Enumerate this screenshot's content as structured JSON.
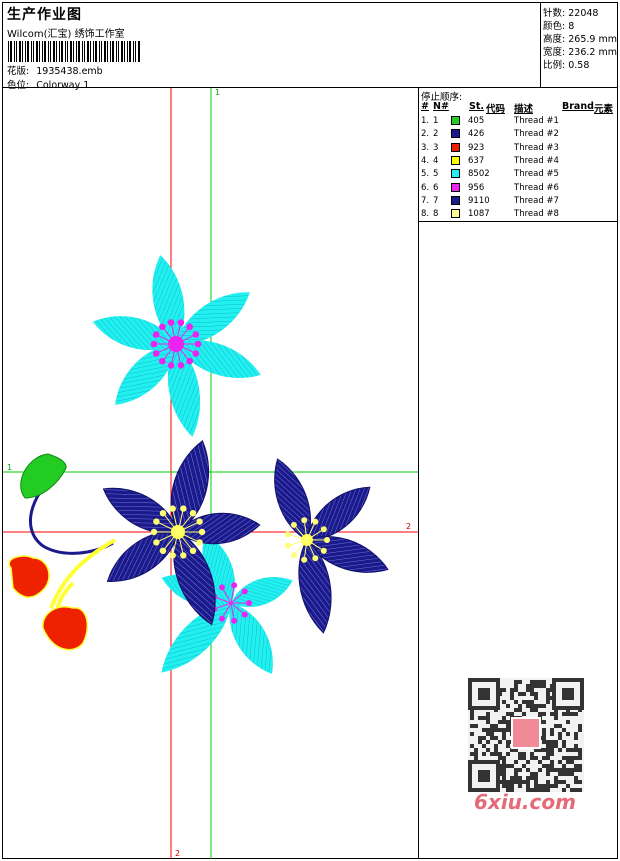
{
  "header": {
    "title": "生产作业图",
    "company": "Wilcom(汇宝) 绣饰工作室",
    "pattern_label": "花版:",
    "pattern_value": "1935438.emb",
    "colorway_label": "色位:",
    "colorway_value": "Colorway 1"
  },
  "stats": {
    "stitches_label": "针数:",
    "stitches_value": "22048",
    "colors_label": "颜色:",
    "colors_value": "8",
    "height_label": "高度:",
    "height_value": "265.9 mm",
    "width_label": "宽度:",
    "width_value": "236.2 mm",
    "scale_label": "比例:",
    "scale_value": "0.58"
  },
  "guides": {
    "marker_top": "1",
    "marker_left": "1",
    "marker_right": "2",
    "marker_bottom": "2"
  },
  "colors": {
    "cyan": "#22f0f0",
    "navy": "#1a1a8c",
    "green": "#22cc22",
    "red": "#ee2200",
    "yellow": "#ffff44",
    "magenta": "#ee22ee",
    "guide_red": "#ff0000",
    "guide_green": "#00cc00"
  },
  "thread_table": {
    "title": "停止顺序:",
    "headers": {
      "stop": "#",
      "num": "N#",
      "st": "St.",
      "code": "代码",
      "desc": "描述",
      "brand": "Brand",
      "elem": "元素"
    },
    "rows": [
      {
        "stop": "1.",
        "num": "1",
        "color": "#22cc22",
        "code": "405",
        "desc": "Thread #1"
      },
      {
        "stop": "2.",
        "num": "2",
        "color": "#1a1a8c",
        "code": "426",
        "desc": "Thread #2"
      },
      {
        "stop": "3.",
        "num": "3",
        "color": "#ee2200",
        "code": "923",
        "desc": "Thread #3"
      },
      {
        "stop": "4.",
        "num": "4",
        "color": "#ffff00",
        "code": "637",
        "desc": "Thread #4"
      },
      {
        "stop": "5.",
        "num": "5",
        "color": "#22f0f0",
        "code": "8502",
        "desc": "Thread #5"
      },
      {
        "stop": "6.",
        "num": "6",
        "color": "#ee22ee",
        "code": "956",
        "desc": "Thread #6"
      },
      {
        "stop": "7.",
        "num": "7",
        "color": "#1a1a8c",
        "code": "9110",
        "desc": "Thread #7"
      },
      {
        "stop": "8.",
        "num": "8",
        "color": "#ffff99",
        "code": "1087",
        "desc": "Thread #8"
      }
    ]
  },
  "watermark": "6xiu.com"
}
